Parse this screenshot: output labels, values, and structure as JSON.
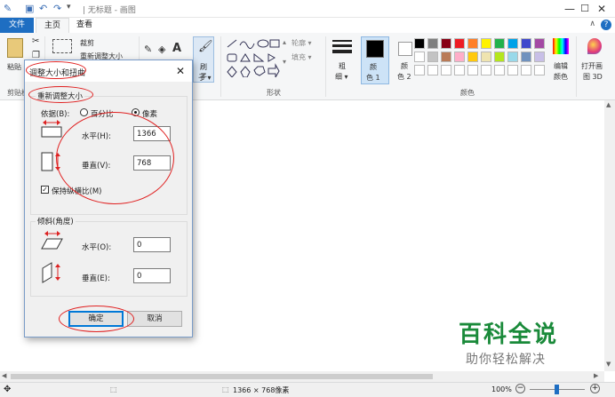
{
  "window": {
    "title": "| 无标题 - 画图",
    "buttons": {
      "minimize": "—",
      "maximize": "☐",
      "close": "✕"
    }
  },
  "tabs": [
    {
      "label": "文件"
    },
    {
      "label": "主页"
    },
    {
      "label": "查看"
    }
  ],
  "ribbon": {
    "clipboard": {
      "paste": "粘贴",
      "group": "剪贴板"
    },
    "image": {
      "crop": "裁剪",
      "resize": "重新调整大小"
    },
    "brushes": {
      "label": "刷子",
      "sub": "子 ▾"
    },
    "shapes": {
      "outline": "轮廓 ▾",
      "fill": "填充 ▾",
      "group": "形状"
    },
    "size": {
      "label": "粗",
      "sub": "细 ▾"
    },
    "color1": {
      "label": "颜",
      "sub": "色 1"
    },
    "color2": {
      "label": "颜",
      "sub": "色 2"
    },
    "edit_colors": {
      "label": "编辑",
      "sub": "颜色"
    },
    "open3d": {
      "label": "打开画",
      "sub": "图 3D"
    },
    "colors_group": "颜色",
    "palette_row1": [
      "#000000",
      "#7f7f7f",
      "#880015",
      "#ed1c24",
      "#ff7f27",
      "#fff200",
      "#22b14c",
      "#00a2e8",
      "#3f48cc",
      "#a349a4"
    ],
    "palette_row2": [
      "#ffffff",
      "#c3c3c3",
      "#b97a57",
      "#ffaec9",
      "#ffc90e",
      "#efe4b0",
      "#b5e61d",
      "#99d9ea",
      "#7092be",
      "#c8bfe7"
    ]
  },
  "dialog": {
    "title": "调整大小和扭曲",
    "resize_group": "重新调整大小",
    "by_label": "依据(B):",
    "percent": "百分比",
    "pixels": "像素",
    "horizontal_label": "水平(H):",
    "horizontal_value": "1366",
    "vertical_label": "垂直(V):",
    "vertical_value": "768",
    "keep_ratio": "保持纵横比(M)",
    "skew_group": "倾斜(角度)",
    "skew_h_label": "水平(O):",
    "skew_h_value": "0",
    "skew_v_label": "垂直(E):",
    "skew_v_value": "0",
    "ok": "确定",
    "cancel": "取消"
  },
  "status": {
    "size": "1366 × 768像素",
    "zoom": "100%"
  },
  "watermark": {
    "main": "百科全说",
    "sub": "助你轻松解决"
  }
}
